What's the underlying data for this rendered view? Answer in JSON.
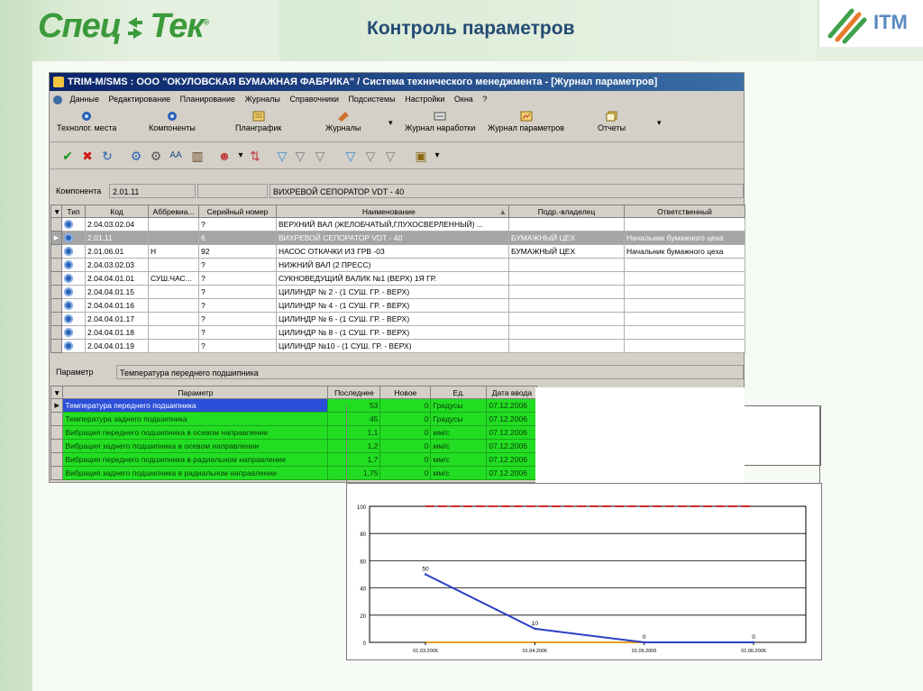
{
  "slide": {
    "logo_left": "Спец",
    "logo_right": "Тек",
    "title": "Контроль параметров",
    "logo_itm": "ITM"
  },
  "window": {
    "title": "TRIM-M/SMS : ООО \"ОКУЛОВСКАЯ БУМАЖНАЯ ФАБРИКА\" / Система технического менеджмента - [Журнал параметров]"
  },
  "menu": [
    "Данные",
    "Редактирование",
    "Планирование",
    "Журналы",
    "Справочники",
    "Подсистемы",
    "Настройки",
    "Окна",
    "?"
  ],
  "toolbar": {
    "buttons": [
      {
        "label": "Технолог. места",
        "icon": "tech-places-icon"
      },
      {
        "label": "Компоненты",
        "icon": "components-icon"
      },
      {
        "label": "Планграфик",
        "icon": "schedule-icon"
      },
      {
        "label": "Журналы",
        "icon": "journals-icon"
      },
      {
        "label": "Журнал наработки",
        "icon": "runtime-log-icon"
      },
      {
        "label": "Журнал параметров",
        "icon": "params-log-icon"
      },
      {
        "label": "Отчеты",
        "icon": "reports-icon"
      }
    ]
  },
  "component": {
    "label": "Компонента",
    "code": "2.01.11",
    "name": "ВИХРЕВОЙ СЕПОРАТОР VDT - 40"
  },
  "components_table": {
    "columns": [
      "Тип",
      "Код",
      "Аббревиа...",
      "Серийный номер",
      "Наименование",
      "Подр.-владелец",
      "Ответственный"
    ],
    "rows": [
      {
        "code": "2.04.03.02.04",
        "abbr": "",
        "serial": "?",
        "name": "ВЕРХНИЙ ВАЛ (ЖЕЛОБЧАТЫЙ,ГЛУХОСВЕРЛЕННЫЙ) ...",
        "owner": "",
        "responsible": ""
      },
      {
        "code": "2.01.11",
        "abbr": "",
        "serial": "6",
        "name": "ВИХРЕВОЙ СЕПОРАТОР VDT - 40",
        "owner": "БУМАЖНЫЙ ЦЕХ",
        "responsible": "Начальник бумажного цеха"
      },
      {
        "code": "2.01.06.01",
        "abbr": "Н",
        "serial": "92",
        "name": "НАСОС ОТКАЧКИ ИЗ ГРВ -03",
        "owner": "БУМАЖНЫЙ ЦЕХ",
        "responsible": "Начальник бумажного цеха"
      },
      {
        "code": "2.04.03.02.03",
        "abbr": "",
        "serial": "?",
        "name": "НИЖНИЙ ВАЛ (2 ПРЕСС)",
        "owner": "",
        "responsible": ""
      },
      {
        "code": "2.04.04.01.01",
        "abbr": "СУШ.ЧАС...",
        "serial": "?",
        "name": "СУКНОВЕДУЩИЙ ВАЛИК №1 (ВЕРХ) 1Я ГР.",
        "owner": "",
        "responsible": ""
      },
      {
        "code": "2.04.04.01.15",
        "abbr": "",
        "serial": "?",
        "name": "ЦИЛИНДР № 2 - (1 СУШ. ГР. - ВЕРХ)",
        "owner": "",
        "responsible": ""
      },
      {
        "code": "2.04.04.01.16",
        "abbr": "",
        "serial": "?",
        "name": "ЦИЛИНДР № 4 - (1 СУШ. ГР. - ВЕРХ)",
        "owner": "",
        "responsible": ""
      },
      {
        "code": "2.04.04.01.17",
        "abbr": "",
        "serial": "?",
        "name": "ЦИЛИНДР № 6 - (1 СУШ. ГР. - ВЕРХ)",
        "owner": "",
        "responsible": ""
      },
      {
        "code": "2.04.04.01.18",
        "abbr": "",
        "serial": "?",
        "name": "ЦИЛИНДР № 8 - (1 СУШ. ГР. - ВЕРХ)",
        "owner": "",
        "responsible": ""
      },
      {
        "code": "2.04.04.01.19",
        "abbr": "",
        "serial": "?",
        "name": "ЦИЛИНДР №10 - (1 СУШ. ГР. - ВЕРХ)",
        "owner": "",
        "responsible": ""
      }
    ],
    "selected_index": 1
  },
  "parameter": {
    "label": "Параметр",
    "value": "Температура переднего подшипника"
  },
  "params_table": {
    "columns": [
      "Параметр",
      "Последнее",
      "Новое",
      "Ед.",
      "Дата ввода"
    ],
    "rows": [
      {
        "name": "Температура переднего подшипника",
        "last": "53",
        "new": "0",
        "unit": "Градусы",
        "date": "07.12.2006"
      },
      {
        "name": "Температура заднего подшипника",
        "last": "45",
        "new": "0",
        "unit": "Градусы",
        "date": "07.12.2006"
      },
      {
        "name": "Вибрация переднего подшипника в осевом направлении",
        "last": "1,1",
        "new": "0",
        "unit": "мм/с",
        "date": "07.12.2006"
      },
      {
        "name": "Вибрация заднего подшипника в осевом направлении",
        "last": "1,2",
        "new": "0",
        "unit": "мм/с",
        "date": "07.12.2006"
      },
      {
        "name": "Вибрация переднего подшипника в радиальном направлении",
        "last": "1,7",
        "new": "0",
        "unit": "мм/с",
        "date": "07.12.2006"
      },
      {
        "name": "Вибрация заднего подшипника в радиальном направлении",
        "last": "1,75",
        "new": "0",
        "unit": "мм/с",
        "date": "07.12.2006"
      }
    ],
    "selected_index": 0
  },
  "chart_data": {
    "type": "line",
    "title": "",
    "xlabel": "",
    "ylabel": "",
    "categories": [
      "01.03.2006",
      "01.04.2006",
      "01.05.2006",
      "01.06.2006"
    ],
    "series": [
      {
        "values": [
          50,
          10,
          0,
          0
        ],
        "color": "#2b3fc4",
        "data_labels": [
          "50",
          "10",
          "0",
          "0"
        ]
      }
    ],
    "thresholds": [
      {
        "value": 100,
        "color": "#d12a2a",
        "style": "dashed"
      },
      {
        "value": 0,
        "color": "#e8a020",
        "style": "solid"
      }
    ],
    "ylim": [
      0,
      100
    ],
    "yticks": [
      "0",
      "20",
      "40",
      "60",
      "80",
      "100"
    ],
    "grid": true,
    "legend": "none"
  }
}
